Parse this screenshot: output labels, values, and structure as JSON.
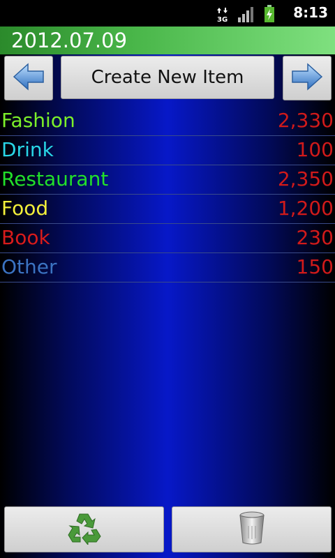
{
  "status_bar": {
    "time": "8:13",
    "icons": [
      "data-3g-icon",
      "signal-icon",
      "battery-charging-icon"
    ]
  },
  "header": {
    "date": "2012.07.09"
  },
  "toolbar": {
    "prev_icon": "arrow-left-icon",
    "create_label": "Create New Item",
    "next_icon": "arrow-right-icon"
  },
  "items": [
    {
      "name": "Fashion",
      "amount": "2,330",
      "color": "#7cf02a"
    },
    {
      "name": "Drink",
      "amount": "100",
      "color": "#29d6e6"
    },
    {
      "name": "Restaurant",
      "amount": "2,350",
      "color": "#22e02a"
    },
    {
      "name": "Food",
      "amount": "1,200",
      "color": "#f2ef3a"
    },
    {
      "name": "Book",
      "amount": "230",
      "color": "#d81b1b"
    },
    {
      "name": "Other",
      "amount": "150",
      "color": "#3b73c2"
    }
  ],
  "bottom": {
    "recycle_icon": "recycle-icon",
    "trash_icon": "trash-can-icon"
  },
  "colors": {
    "amount": "#d11a1a",
    "header_green": "#49b649"
  }
}
